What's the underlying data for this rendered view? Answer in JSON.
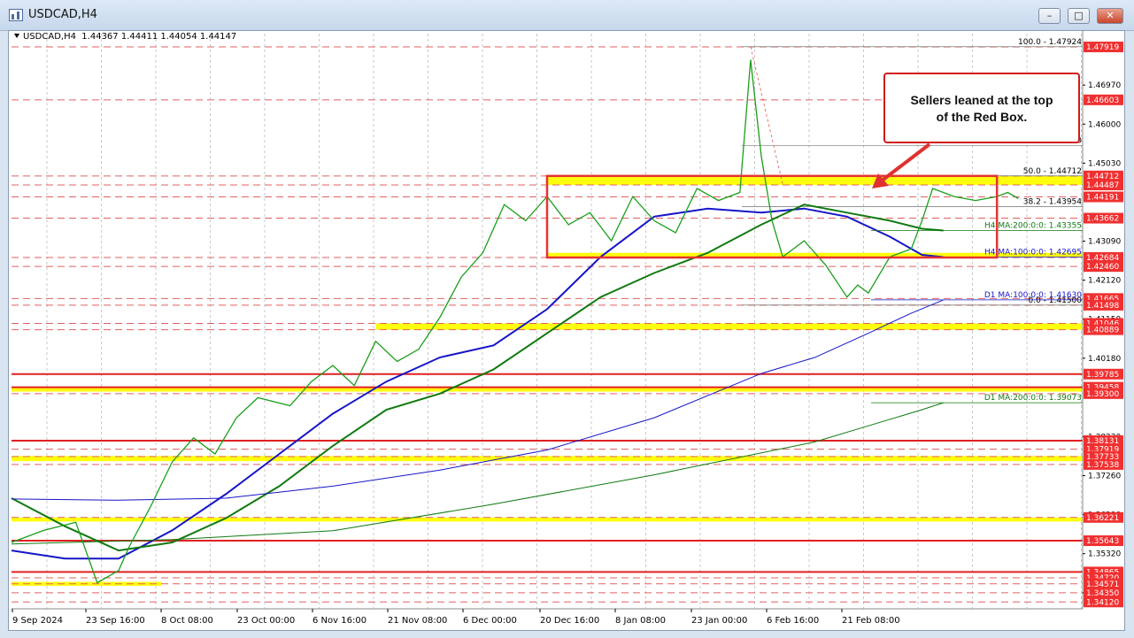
{
  "window": {
    "title": "USDCAD,H4",
    "buttons": [
      "minimize",
      "restore",
      "close"
    ]
  },
  "symbol_info": "USDCAD,H4  1.44367 1.44411 1.44054 1.44147",
  "annotation": {
    "callout_line1": "Sellers leaned at the top",
    "callout_line2": "of the Red Box."
  },
  "colors": {
    "candle": "#1a9e1a",
    "ma100": "#1515c8",
    "ma200": "#0f7a0f",
    "box": "#e53333",
    "zone": "#ffff00",
    "dashed": "#e06060",
    "solid_red": "#e02020"
  },
  "chart_data": {
    "type": "line",
    "title": "USDCAD,H4",
    "symbol": "USDCAD",
    "timeframe": "H4",
    "ohlc_header": {
      "open": 1.44367,
      "high": 1.44411,
      "low": 1.44054,
      "close": 1.44147
    },
    "ylim": [
      1.3395,
      1.4825
    ],
    "x_tick_labels": [
      "9 Sep 2024",
      "23 Sep 16:00",
      "8 Oct 08:00",
      "23 Oct 00:00",
      "6 Nov 16:00",
      "21 Nov 08:00",
      "6 Dec 00:00",
      "20 Dec 16:00",
      "8 Jan 08:00",
      "23 Jan 00:00",
      "6 Feb 16:00",
      "21 Feb 08:00"
    ],
    "y_tick_labels": [
      1.4697,
      1.46,
      1.4503,
      1.4309,
      1.4212,
      1.4115,
      1.4018,
      1.3823,
      1.3726,
      1.3629,
      1.3532,
      1.3435
    ],
    "price_tags": [
      {
        "value": 1.47919,
        "style": "dashed"
      },
      {
        "value": 1.46603,
        "style": "dashed"
      },
      {
        "value": 1.44712,
        "style": "dashed"
      },
      {
        "value": 1.44487,
        "style": "dashed"
      },
      {
        "value": 1.44191,
        "style": "dashed"
      },
      {
        "value": 1.43662,
        "style": "dashed"
      },
      {
        "value": 1.42684,
        "style": "dashed"
      },
      {
        "value": 1.4246,
        "style": "dashed"
      },
      {
        "value": 1.41665,
        "style": "dashed"
      },
      {
        "value": 1.41498,
        "style": "dashed"
      },
      {
        "value": 1.41046,
        "style": "dashed"
      },
      {
        "value": 1.40889,
        "style": "dashed"
      },
      {
        "value": 1.39785,
        "style": "solid"
      },
      {
        "value": 1.39458,
        "style": "solid"
      },
      {
        "value": 1.393,
        "style": "dashed"
      },
      {
        "value": 1.38131,
        "style": "solid"
      },
      {
        "value": 1.37919,
        "style": "dashed"
      },
      {
        "value": 1.37733,
        "style": "dashed"
      },
      {
        "value": 1.37538,
        "style": "dashed"
      },
      {
        "value": 1.36221,
        "style": "dashed"
      },
      {
        "value": 1.35643,
        "style": "solid"
      },
      {
        "value": 1.34865,
        "style": "solid"
      },
      {
        "value": 1.3472,
        "style": "dashed"
      },
      {
        "value": 1.34571,
        "style": "dashed"
      },
      {
        "value": 1.3435,
        "style": "dashed"
      },
      {
        "value": 1.3412,
        "style": "dashed"
      }
    ],
    "fibonacci": [
      {
        "label": "100.0 - 1.47924",
        "value": 1.47924
      },
      {
        "label": "61.8 - 1.45470",
        "value": 1.4547
      },
      {
        "label": "50.0 - 1.44712",
        "value": 1.44712
      },
      {
        "label": "38.2 - 1.43954",
        "value": 1.43954
      },
      {
        "label": "0.0 - 1.41500",
        "value": 1.415
      }
    ],
    "ma_labels": [
      {
        "label": "H4 MA:200:0:0: 1.43355",
        "value": 1.43355,
        "series": "ma200"
      },
      {
        "label": "H4 MA:100:0:0: 1.42695",
        "value": 1.42695,
        "series": "ma100"
      },
      {
        "label": "D1 MA:100:0:0: 1.41630",
        "value": 1.4163,
        "series": "ma100"
      },
      {
        "label": "D1 MA:200:0:0: 1.39073",
        "value": 1.39073,
        "series": "ma200"
      }
    ],
    "zones": [
      {
        "low": 1.44487,
        "high": 1.44712,
        "x_from": 0.5,
        "x_to": 1.0
      },
      {
        "low": 1.42684,
        "high": 1.428,
        "x_from": 0.5,
        "x_to": 1.0
      },
      {
        "low": 1.40889,
        "high": 1.41046,
        "x_from": 0.34,
        "x_to": 1.0
      },
      {
        "low": 1.3935,
        "high": 1.3945,
        "x_from": 0.0,
        "x_to": 1.0
      },
      {
        "low": 1.3762,
        "high": 1.3775,
        "x_from": 0.0,
        "x_to": 1.0
      },
      {
        "low": 1.3612,
        "high": 1.3622,
        "x_from": 0.0,
        "x_to": 1.0
      },
      {
        "low": 1.3452,
        "high": 1.3462,
        "x_from": 0.0,
        "x_to": 0.14
      }
    ],
    "red_box": {
      "low": 1.42684,
      "high": 1.44712,
      "x_from": 0.5,
      "x_to": 0.92
    },
    "price_series": {
      "name": "USDCAD",
      "x": [
        0,
        0.03,
        0.06,
        0.08,
        0.1,
        0.11,
        0.13,
        0.15,
        0.17,
        0.19,
        0.21,
        0.23,
        0.26,
        0.28,
        0.3,
        0.32,
        0.34,
        0.36,
        0.38,
        0.4,
        0.42,
        0.44,
        0.46,
        0.48,
        0.5,
        0.52,
        0.54,
        0.56,
        0.58,
        0.6,
        0.62,
        0.64,
        0.66,
        0.68,
        0.69,
        0.7,
        0.71,
        0.72,
        0.74,
        0.76,
        0.78,
        0.79,
        0.8,
        0.82,
        0.84,
        0.85,
        0.86,
        0.88,
        0.9,
        0.92,
        0.93,
        0.94
      ],
      "y": [
        1.356,
        1.359,
        1.361,
        1.346,
        1.349,
        1.355,
        1.365,
        1.376,
        1.382,
        1.378,
        1.387,
        1.392,
        1.39,
        1.396,
        1.4,
        1.395,
        1.406,
        1.401,
        1.404,
        1.412,
        1.422,
        1.428,
        1.44,
        1.436,
        1.442,
        1.435,
        1.438,
        1.431,
        1.442,
        1.436,
        1.433,
        1.444,
        1.441,
        1.443,
        1.476,
        1.452,
        1.436,
        1.427,
        1.431,
        1.425,
        1.417,
        1.42,
        1.418,
        1.427,
        1.429,
        1.436,
        1.444,
        1.442,
        1.441,
        1.442,
        1.443,
        1.4415
      ]
    },
    "series": [
      {
        "name": "H4 MA:100",
        "x": [
          0,
          0.05,
          0.1,
          0.15,
          0.2,
          0.25,
          0.3,
          0.35,
          0.4,
          0.45,
          0.5,
          0.55,
          0.6,
          0.65,
          0.7,
          0.74,
          0.78,
          0.82,
          0.85,
          0.87
        ],
        "y": [
          1.354,
          1.352,
          1.352,
          1.359,
          1.368,
          1.378,
          1.388,
          1.396,
          1.402,
          1.405,
          1.414,
          1.427,
          1.437,
          1.439,
          1.438,
          1.439,
          1.437,
          1.432,
          1.4275,
          1.42695
        ]
      },
      {
        "name": "H4 MA:200",
        "x": [
          0,
          0.05,
          0.1,
          0.15,
          0.2,
          0.25,
          0.3,
          0.35,
          0.4,
          0.45,
          0.5,
          0.55,
          0.6,
          0.65,
          0.7,
          0.74,
          0.78,
          0.82,
          0.85,
          0.87
        ],
        "y": [
          1.367,
          1.36,
          1.354,
          1.356,
          1.362,
          1.37,
          1.38,
          1.389,
          1.393,
          1.399,
          1.408,
          1.417,
          1.423,
          1.428,
          1.435,
          1.44,
          1.438,
          1.436,
          1.434,
          1.43355
        ]
      },
      {
        "name": "D1 MA:100",
        "x": [
          0,
          0.1,
          0.2,
          0.3,
          0.4,
          0.5,
          0.6,
          0.7,
          0.75,
          0.8,
          0.84,
          0.87
        ],
        "y": [
          1.3668,
          1.3665,
          1.367,
          1.37,
          1.374,
          1.379,
          1.387,
          1.398,
          1.402,
          1.408,
          1.413,
          1.4163
        ]
      },
      {
        "name": "D1 MA:200",
        "x": [
          0,
          0.15,
          0.3,
          0.45,
          0.6,
          0.75,
          0.8,
          0.85,
          0.87
        ],
        "y": [
          1.3556,
          1.3567,
          1.3589,
          1.3655,
          1.3728,
          1.381,
          1.385,
          1.389,
          1.39073
        ]
      }
    ]
  }
}
